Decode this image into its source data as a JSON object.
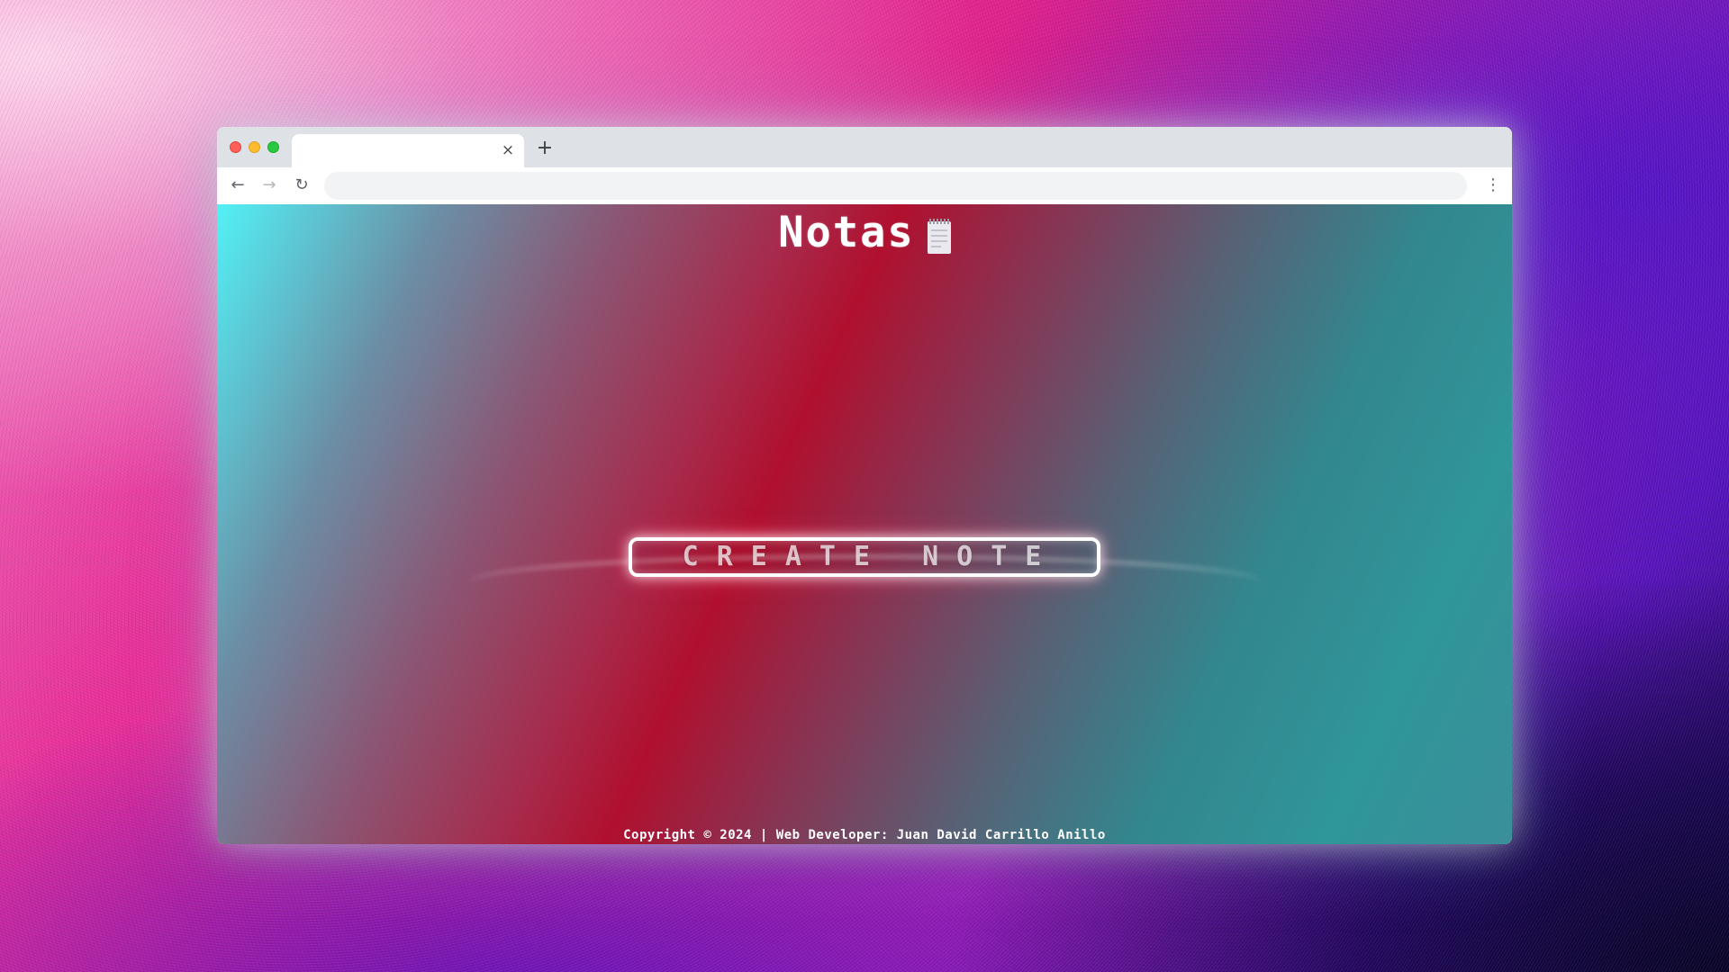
{
  "browser": {
    "tab_title": "",
    "tab_close_glyph": "×",
    "new_tab_glyph": "+",
    "back_glyph": "←",
    "forward_glyph": "→",
    "reload_glyph": "↻",
    "menu_glyph": "⋮",
    "address_value": ""
  },
  "app": {
    "title": "Notas",
    "title_icon": "notepad-icon",
    "create_button_label": "CREATE NOTE",
    "footer_text": "Copyright © 2024 | Web Developer: Juan David Carrillo Anillo"
  }
}
